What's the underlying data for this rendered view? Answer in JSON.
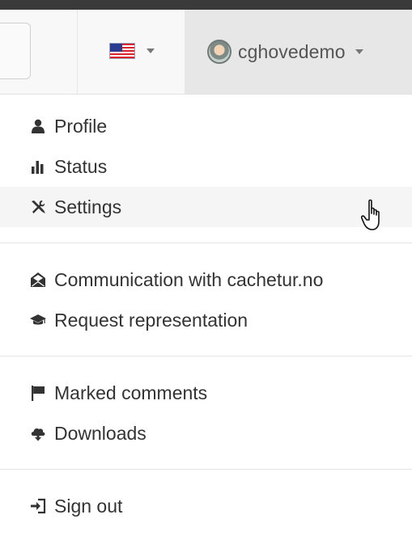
{
  "navbar": {
    "language": {
      "flag_icon": "us-flag-icon",
      "caret_icon": "caret-down-icon"
    },
    "user": {
      "avatar_icon": "user-avatar",
      "username": "cghovedemo",
      "caret_icon": "caret-down-icon"
    }
  },
  "menu": {
    "groups": [
      [
        {
          "label": "Profile",
          "icon": "user-icon"
        },
        {
          "label": "Status",
          "icon": "stats-icon"
        },
        {
          "label": "Settings",
          "icon": "wrench-screwdriver-icon"
        }
      ],
      [
        {
          "label": "Communication with cachetur.no",
          "icon": "open-envelope-icon"
        },
        {
          "label": "Request representation",
          "icon": "graduation-cap-icon"
        }
      ],
      [
        {
          "label": "Marked comments",
          "icon": "flag-icon"
        },
        {
          "label": "Downloads",
          "icon": "cloud-download-icon"
        }
      ],
      [
        {
          "label": "Sign out",
          "icon": "sign-out-icon"
        }
      ]
    ]
  },
  "cursor": {
    "icon": "hand-pointer-icon",
    "hovered_item": "Settings"
  },
  "colors": {
    "navbar_bg": "#f8f8f8",
    "active_toggle_bg": "#e7e7e7",
    "hover_item_bg": "#f5f5f5",
    "text": "#333333",
    "nav_text": "#555555"
  }
}
